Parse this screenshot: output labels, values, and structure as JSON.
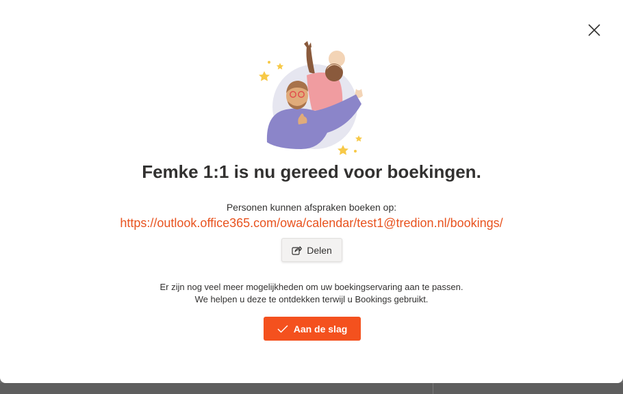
{
  "dialog": {
    "title": "Femke 1:1 is nu gereed voor boekingen.",
    "subtitle": "Personen kunnen afspraken boeken op:",
    "booking_link": "https://outlook.office365.com/owa/calendar/test1@tredion.nl/bookings/",
    "share_button": {
      "label": "Delen",
      "icon": "share-icon"
    },
    "info_line_1": "Er zijn nog veel meer mogelijkheden om uw boekingservaring aan te passen.",
    "info_line_2": "We helpen u deze te ontdekken terwijl u Bookings gebruikt.",
    "primary_button": {
      "label": "Aan de slag",
      "icon": "checkmark-icon"
    },
    "close_icon": "close-icon"
  },
  "colors": {
    "accent": "#f4511e",
    "link": "#e8531f",
    "text": "#323130"
  }
}
